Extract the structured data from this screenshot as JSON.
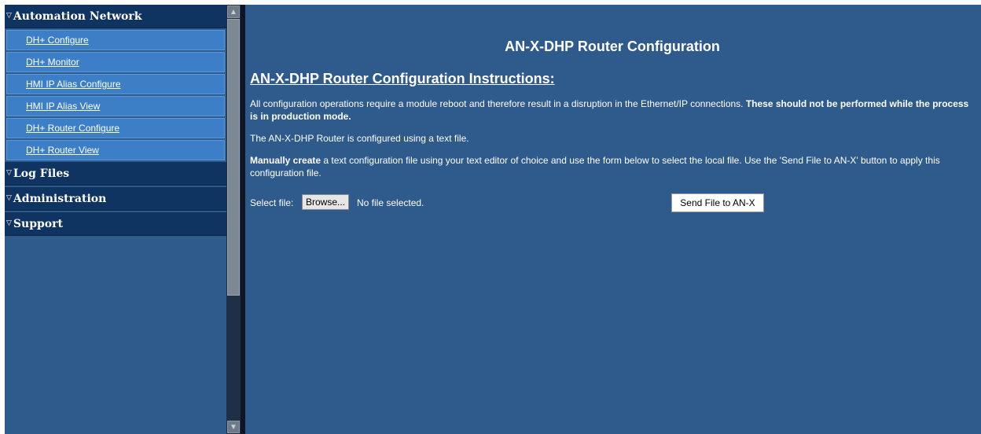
{
  "sidebar": {
    "sections": [
      {
        "label": "Automation Network",
        "items": [
          {
            "label": "DH+ Configure"
          },
          {
            "label": "DH+ Monitor"
          },
          {
            "label": "HMI IP Alias Configure"
          },
          {
            "label": "HMI IP Alias View"
          },
          {
            "label": "DH+ Router Configure"
          },
          {
            "label": "DH+ Router View"
          }
        ]
      },
      {
        "label": "Log Files"
      },
      {
        "label": "Administration"
      },
      {
        "label": "Support"
      }
    ],
    "expand_icon": "triangle-down-icon"
  },
  "main": {
    "title": "AN-X-DHP Router Configuration",
    "instructions_title": "AN-X-DHP Router Configuration Instructions:",
    "para1_text": "All configuration operations require a module reboot and therefore result in a disruption in the Ethernet/IP connections. ",
    "para1_bold": "These should not be performed while the process is in production mode.",
    "para2_text": "The AN-X-DHP Router is configured using a text file.",
    "para3_bold": "Manually create",
    "para3_text": " a text configuration file using your text editor of choice and use the form below to select the local file. Use the 'Send File to AN-X' button to apply this configuration file.",
    "file_label": "Select file:",
    "browse_label": "Browse...",
    "file_status": "No file selected.",
    "send_label": "Send File to AN-X"
  },
  "colors": {
    "background": "#2e5a8c",
    "section_header": "#0f3461",
    "nav_item": "#3d7fc7",
    "text": "#ffffff"
  }
}
